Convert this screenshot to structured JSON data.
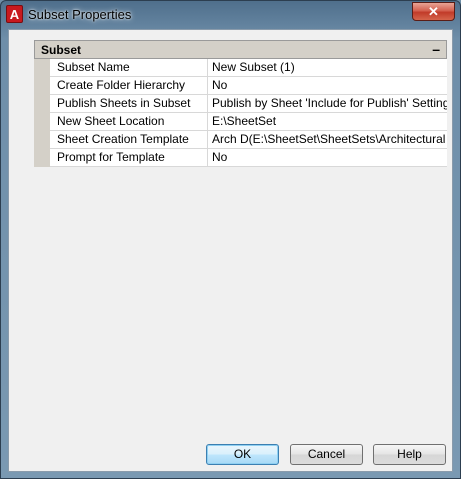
{
  "window": {
    "title": "Subset Properties",
    "app_icon_letter": "A",
    "close_glyph": "✕"
  },
  "category": {
    "title": "Subset",
    "toggle": "–"
  },
  "properties": [
    {
      "name": "Subset Name",
      "value": "New Subset (1)"
    },
    {
      "name": "Create Folder Hierarchy",
      "value": "No"
    },
    {
      "name": "Publish Sheets in Subset",
      "value": "Publish by Sheet 'Include for Publish' Setting"
    },
    {
      "name": "New Sheet Location",
      "value": "E:\\SheetSet"
    },
    {
      "name": "Sheet Creation Template",
      "value": "Arch D(E:\\SheetSet\\SheetSets\\Architectural I.."
    },
    {
      "name": "Prompt for Template",
      "value": "No"
    }
  ],
  "buttons": {
    "ok": "OK",
    "cancel": "Cancel",
    "help": "Help"
  }
}
